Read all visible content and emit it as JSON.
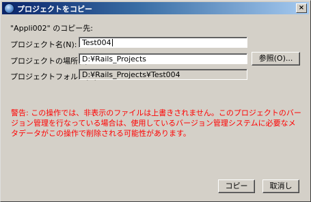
{
  "window": {
    "title": "プロジェクトをコピー",
    "close_glyph": "×"
  },
  "header_text": "\"Appli002\" のコピー先:",
  "project_name": {
    "label": "プロジェクト名(N):",
    "value": "Test004"
  },
  "project_location": {
    "label": "プロジェクトの場所(L):",
    "value": "D:¥Rails_Projects",
    "browse_label": "参照(O)..."
  },
  "project_folder": {
    "label": "プロジェクトフォルダ(D):",
    "value": "D:¥Rails_Projects¥Test004"
  },
  "warning": "警告: この操作では、非表示のファイルは上書きされません。このプロジェクトのバージョン管理を行なっている場合は、使用しているバージョン管理システムに必要なメタデータがこの操作で削除される可能性があります。",
  "buttons": {
    "copy": "コピー",
    "cancel": "取消し"
  }
}
